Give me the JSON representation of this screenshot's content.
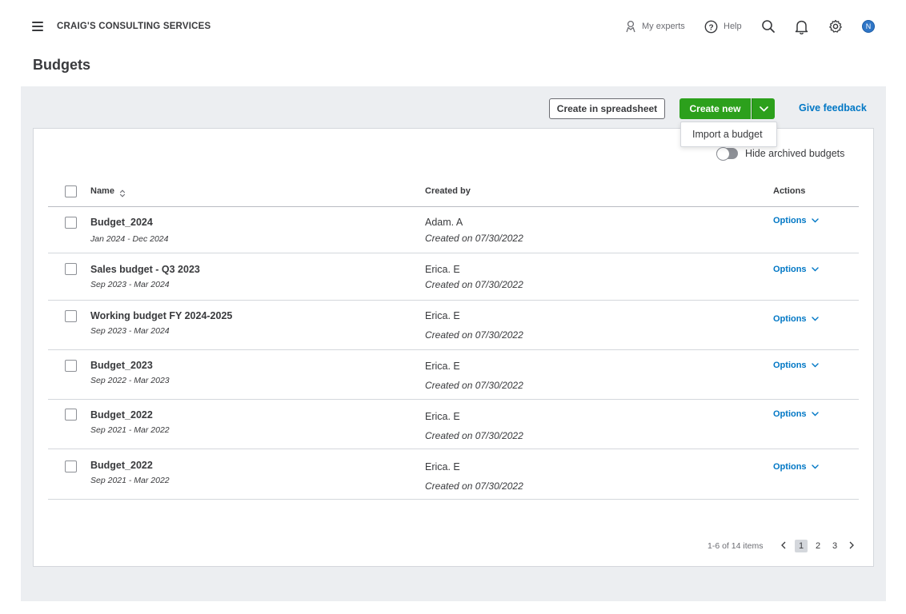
{
  "header": {
    "company_name": "CRAIG'S CONSULTING SERVICES",
    "my_experts_label": "My experts",
    "help_label": "Help",
    "avatar_initial": "N"
  },
  "page": {
    "title": "Budgets"
  },
  "toolbar": {
    "create_spreadsheet_label": "Create in spreadsheet",
    "create_new_label": "Create new",
    "give_feedback_label": "Give feedback",
    "dropdown_item": "Import a budget"
  },
  "filters": {
    "hide_archived_label": "Hide archived budgets"
  },
  "table": {
    "columns": {
      "name": "Name",
      "created_by": "Created by",
      "actions": "Actions"
    },
    "rows": [
      {
        "name": "Budget_2024",
        "period": "Jan 2024 - Dec 2024",
        "created_by": "Adam. A",
        "created_on": "Created on 07/30/2022",
        "action": "Options"
      },
      {
        "name": "Sales budget - Q3 2023",
        "period": "Sep 2023 - Mar 2024",
        "created_by": "Erica. E",
        "created_on": "Created on 07/30/2022",
        "action": "Options"
      },
      {
        "name": "Working budget  FY 2024-2025",
        "period": "Sep 2023 - Mar 2024",
        "created_by": "Erica. E",
        "created_on": "Created on 07/30/2022",
        "action": "Options"
      },
      {
        "name": "Budget_2023",
        "period": "Sep 2022 - Mar 2023",
        "created_by": "Erica. E",
        "created_on": "Created on 07/30/2022",
        "action": "Options"
      },
      {
        "name": "Budget_2022",
        "period": "Sep 2021 - Mar 2022",
        "created_by": "Erica. E",
        "created_on": "Created on 07/30/2022",
        "action": "Options"
      },
      {
        "name": "Budget_2022",
        "period": "Sep 2021 - Mar 2022",
        "created_by": "Erica. E",
        "created_on": "Created on 07/30/2022",
        "action": "Options"
      }
    ]
  },
  "pagination": {
    "info": "1-6 of 14 items",
    "pages": [
      "1",
      "2",
      "3"
    ],
    "current_page": "1"
  },
  "colors": {
    "brand_green": "#2ca01c",
    "link_blue": "#0077c5",
    "panel_bg": "#eceef1"
  }
}
